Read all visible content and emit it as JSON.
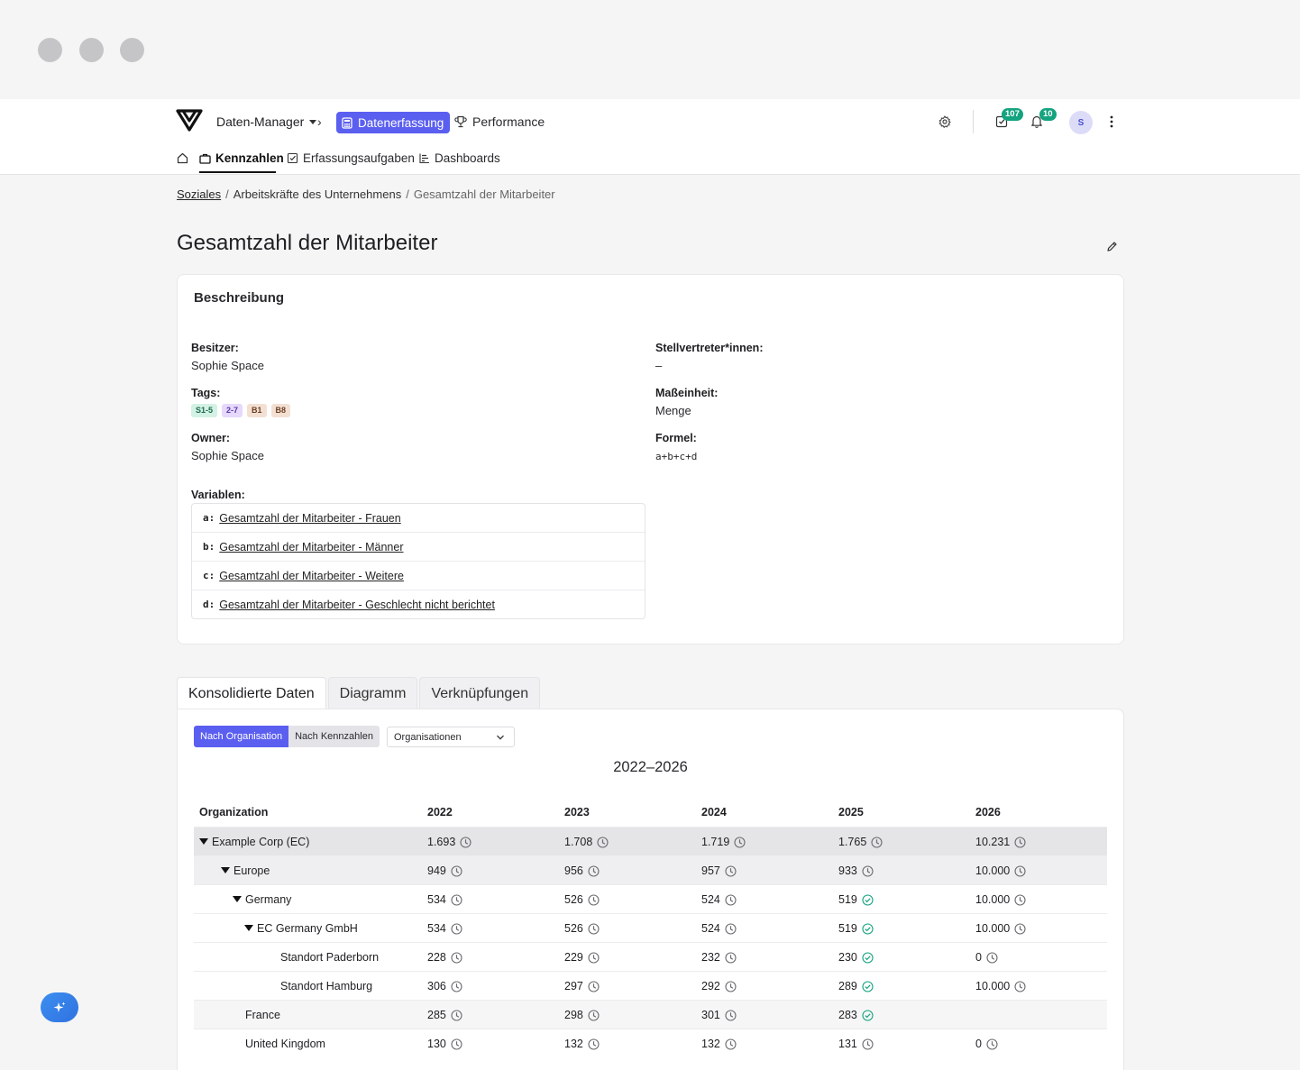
{
  "header": {
    "app_switch": "Daten-Manager",
    "nav_active": "Datenerfassung",
    "nav_performance": "Performance",
    "tasks_badge": "107",
    "notifications_badge": "10",
    "avatar_initial": "S"
  },
  "subnav": {
    "kennzahlen": "Kennzahlen",
    "erfassungsaufgaben": "Erfassungsaufgaben",
    "dashboards": "Dashboards"
  },
  "breadcrumb": {
    "item1": "Soziales",
    "item2": "Arbeitskräfte des Unternehmens",
    "current": "Gesamtzahl der Mitarbeiter"
  },
  "page_title": "Gesamtzahl der Mitarbeiter",
  "description": {
    "title": "Beschreibung",
    "besitzer_label": "Besitzer:",
    "besitzer_value": "Sophie Space",
    "stellvertreter_label": "Stellvertreter*innen:",
    "stellvertreter_value": "–",
    "tags_label": "Tags:",
    "tags": [
      {
        "text": "S1-5",
        "bg": "#d3f1e4",
        "fg": "#1d6b4b"
      },
      {
        "text": "2-7",
        "bg": "#e6d9fb",
        "fg": "#5a3aa3"
      },
      {
        "text": "B1",
        "bg": "#f3e0d3",
        "fg": "#6b3f24"
      },
      {
        "text": "B8",
        "bg": "#f3e0d3",
        "fg": "#6b3f24"
      }
    ],
    "masseinheit_label": "Maßeinheit:",
    "masseinheit_value": "Menge",
    "owner_label": "Owner:",
    "owner_value": "Sophie Space",
    "formel_label": "Formel:",
    "formel_value": "a+b+c+d",
    "variablen_label": "Variablen:",
    "variables": [
      {
        "key": "a:",
        "name": "Gesamtzahl der Mitarbeiter - Frauen"
      },
      {
        "key": "b:",
        "name": "Gesamtzahl der Mitarbeiter - Männer"
      },
      {
        "key": "c:",
        "name": "Gesamtzahl der Mitarbeiter - Weitere"
      },
      {
        "key": "d:",
        "name": "Gesamtzahl der Mitarbeiter - Geschlecht nicht berichtet"
      }
    ]
  },
  "tabs": [
    "Konsolidierte Daten",
    "Diagramm",
    "Verknüpfungen"
  ],
  "data_panel": {
    "seg_by_org": "Nach Organisation",
    "seg_by_kpi": "Nach Kennzahlen",
    "org_select": "Organisationen",
    "range_title": "2022–2026",
    "columns": [
      "Organization",
      "2022",
      "2023",
      "2024",
      "2025",
      "2026"
    ],
    "rows": [
      {
        "name": "Example Corp (EC)",
        "level": 0,
        "expanded": true,
        "cells": [
          {
            "v": "1.693",
            "s": "pending"
          },
          {
            "v": "1.708",
            "s": "pending"
          },
          {
            "v": "1.719",
            "s": "pending"
          },
          {
            "v": "1.765",
            "s": "pending"
          },
          {
            "v": "10.231",
            "s": "pending"
          }
        ]
      },
      {
        "name": "Europe",
        "level": 1,
        "expanded": true,
        "cells": [
          {
            "v": "949",
            "s": "pending"
          },
          {
            "v": "956",
            "s": "pending"
          },
          {
            "v": "957",
            "s": "pending"
          },
          {
            "v": "933",
            "s": "pending"
          },
          {
            "v": "10.000",
            "s": "pending"
          }
        ]
      },
      {
        "name": "Germany",
        "level": 2,
        "expanded": true,
        "cells": [
          {
            "v": "534",
            "s": "pending"
          },
          {
            "v": "526",
            "s": "pending"
          },
          {
            "v": "524",
            "s": "pending"
          },
          {
            "v": "519",
            "s": "done"
          },
          {
            "v": "10.000",
            "s": "pending"
          }
        ]
      },
      {
        "name": "EC Germany GmbH",
        "level": 3,
        "expanded": true,
        "cells": [
          {
            "v": "534",
            "s": "pending"
          },
          {
            "v": "526",
            "s": "pending"
          },
          {
            "v": "524",
            "s": "pending"
          },
          {
            "v": "519",
            "s": "done"
          },
          {
            "v": "10.000",
            "s": "pending"
          }
        ]
      },
      {
        "name": "Standort Paderborn",
        "level": 4,
        "expanded": false,
        "cells": [
          {
            "v": "228",
            "s": "pending"
          },
          {
            "v": "229",
            "s": "pending"
          },
          {
            "v": "232",
            "s": "pending"
          },
          {
            "v": "230",
            "s": "done"
          },
          {
            "v": "0",
            "s": "pending"
          }
        ]
      },
      {
        "name": "Standort Hamburg",
        "level": 4,
        "expanded": false,
        "cells": [
          {
            "v": "306",
            "s": "pending"
          },
          {
            "v": "297",
            "s": "pending"
          },
          {
            "v": "292",
            "s": "pending"
          },
          {
            "v": "289",
            "s": "done"
          },
          {
            "v": "10.000",
            "s": "pending"
          }
        ]
      },
      {
        "name": "France",
        "level": 2,
        "expanded": false,
        "band": true,
        "cells": [
          {
            "v": "285",
            "s": "pending"
          },
          {
            "v": "298",
            "s": "pending"
          },
          {
            "v": "301",
            "s": "pending"
          },
          {
            "v": "283",
            "s": "done"
          },
          {
            "v": "",
            "s": ""
          }
        ]
      },
      {
        "name": "United Kingdom",
        "level": 2,
        "expanded": false,
        "cells": [
          {
            "v": "130",
            "s": "pending"
          },
          {
            "v": "132",
            "s": "pending"
          },
          {
            "v": "132",
            "s": "pending"
          },
          {
            "v": "131",
            "s": "pending"
          },
          {
            "v": "0",
            "s": "pending"
          }
        ]
      }
    ]
  },
  "colors": {
    "accent": "#5b5ff0",
    "badge": "#14a37f",
    "done_status": "#14a37f",
    "pending_status": "#6b6b70"
  },
  "icons": [
    "logo-icon",
    "calculator-icon",
    "trophy-icon",
    "gear-icon",
    "tasks-icon",
    "bell-icon",
    "kebab-icon",
    "home-icon",
    "briefcase-icon",
    "checkbox-icon",
    "list-icon",
    "pencil-icon",
    "chevron-down-icon",
    "clock-icon",
    "check-circle-icon",
    "sparkle-icon"
  ]
}
